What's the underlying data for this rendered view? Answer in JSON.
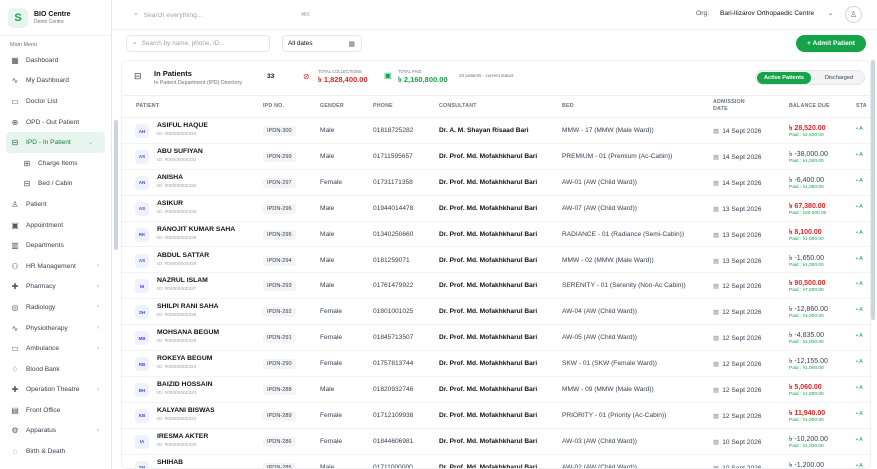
{
  "brand": {
    "logo": "S",
    "name": "BIO Centre",
    "sub": "Demo Centre"
  },
  "sidebar": {
    "heading": "Main Menu",
    "items": [
      {
        "label": "Dashboard",
        "icon": "▦",
        "icon_name": "dashboard-icon"
      },
      {
        "label": "My Dashboard",
        "icon": "∿",
        "icon_name": "activity-icon"
      },
      {
        "label": "Doctor List",
        "icon": "▭",
        "icon_name": "doctor-list-icon"
      },
      {
        "label": "OPD - Out Patient",
        "icon": "⊕",
        "icon_name": "opd-icon"
      },
      {
        "label": "IPD - In Patient",
        "icon": "⊟",
        "icon_name": "bed-icon",
        "chev": "⌄"
      },
      {
        "label": "Charge Items",
        "icon": "⊞",
        "icon_name": "charge-items-icon"
      },
      {
        "label": "Bed / Cabin",
        "icon": "⊟",
        "icon_name": "bed-cabin-icon"
      },
      {
        "label": "Patient",
        "icon": "♙",
        "icon_name": "patient-icon"
      },
      {
        "label": "Appointment",
        "icon": "▣",
        "icon_name": "calendar-icon"
      },
      {
        "label": "Departments",
        "icon": "▥",
        "icon_name": "departments-icon"
      },
      {
        "label": "HR Management",
        "icon": "⚇",
        "icon_name": "hr-icon",
        "chev": "›"
      },
      {
        "label": "Pharmacy",
        "icon": "✚",
        "icon_name": "pharmacy-icon",
        "chev": "›"
      },
      {
        "label": "Radiology",
        "icon": "◎",
        "icon_name": "radiology-icon",
        "chev": "›"
      },
      {
        "label": "Physiotherapy",
        "icon": "∿",
        "icon_name": "physio-icon",
        "chev": "›"
      },
      {
        "label": "Ambulance",
        "icon": "▭",
        "icon_name": "ambulance-icon",
        "chev": "›"
      },
      {
        "label": "Blood Bank",
        "icon": "♢",
        "icon_name": "blood-icon"
      },
      {
        "label": "Operation Theatre",
        "icon": "✚",
        "icon_name": "ot-icon",
        "chev": "›"
      },
      {
        "label": "Front Office",
        "icon": "▤",
        "icon_name": "front-office-icon"
      },
      {
        "label": "Apparatus",
        "icon": "⚙",
        "icon_name": "apparatus-icon",
        "chev": "›"
      },
      {
        "label": "Birth & Death",
        "icon": "◌",
        "icon_name": "birth-death-icon"
      }
    ]
  },
  "topbar": {
    "search_placeholder": "Search everything...",
    "search_kbd": "⌘K",
    "org_label": "Org:",
    "org_value": "Bari-Ilizarov Orthopaedic Centre",
    "org_chev": "⌄",
    "avatar_icon": "♙"
  },
  "filters": {
    "search_placeholder": "Search by name, phone, ID...",
    "date_value": "All dates",
    "calendar_icon": "▦",
    "admit_label": "+  Admit Patient"
  },
  "panel": {
    "icon": "⊟",
    "title": "In Patients",
    "subtitle": "In Patient Department (IPD) Directory",
    "count": "33",
    "collections_label": "TOTAL COLLECTIONS",
    "collections_value": "৳ 1,828,400.00",
    "paid_label": "TOTAL PAID",
    "paid_value": "৳ 2,160,800.00",
    "pending_text": "33 patients · current status",
    "toggle_active": "Active Patients",
    "toggle_discharged": "Discharged"
  },
  "columns": [
    "PATIENT",
    "IPD NO.",
    "GENDER",
    "PHONE",
    "CONSULTANT",
    "BED",
    "ADMISSION DATE",
    "BALANCE DUE",
    "STA"
  ],
  "rows": [
    {
      "initials": "AH",
      "name": "ASIFUL HAQUE",
      "pid": "ID: #00000000334",
      "ipd": "IPDN-300",
      "gender": "Male",
      "phone": "01818725282",
      "consultant": "Dr. A. M. Shayan Risaad Bari",
      "bed": "MMW - 17 (MMW (Male Ward))",
      "date": "14 Sept 2026",
      "balance": "৳ 28,520.00",
      "paid": "Paid : ৳2,600.00",
      "due": true
    },
    {
      "initials": "AS",
      "name": "ABU SUFIYAN",
      "pid": "ID: #00000000333",
      "ipd": "IPDN-299",
      "gender": "Male",
      "phone": "01711595657",
      "consultant": "Dr. Prof. Md. Mofakhkharul Bari",
      "bed": "PREMIUM - 01 (Premium (Ac-Cabin))",
      "date": "14 Sept 2026",
      "balance": "৳ -38,000.00",
      "paid": "Paid : ৳1,000.00",
      "due": false
    },
    {
      "initials": "AN",
      "name": "ANISHA",
      "pid": "ID: #00000000332",
      "ipd": "IPDN-297",
      "gender": "Female",
      "phone": "01731171358",
      "consultant": "Dr. Prof. Md. Mofakhkharul Bari",
      "bed": "AW-01 (AW (Child Ward))",
      "date": "14 Sept 2026",
      "balance": "৳ -6,400.00",
      "paid": "Paid : ৳1,050.00",
      "due": false
    },
    {
      "initials": "AS",
      "name": "ASIKUR",
      "pid": "ID: #00000000330",
      "ipd": "IPDN-296",
      "gender": "Male",
      "phone": "01944014478",
      "consultant": "Dr. Prof. Md. Mofakhkharul Bari",
      "bed": "AW-07 (AW (Child Ward))",
      "date": "13 Sept 2026",
      "balance": "৳ 67,380.00",
      "paid": "Paid : ৳20,000.00",
      "due": true
    },
    {
      "initials": "RK",
      "name": "RANOJIT KUMAR SAHA",
      "pid": "ID: #00000000329",
      "ipd": "IPDN-295",
      "gender": "Male",
      "phone": "01340250660",
      "consultant": "Dr. Prof. Md. Mofakhkharul Bari",
      "bed": "RADIANCE - 01 (Radiance (Semi-Cabin))",
      "date": "13 Sept 2026",
      "balance": "৳ 8,100.00",
      "paid": "Paid : ৳1,000.00",
      "due": true
    },
    {
      "initials": "AS",
      "name": "ABDUL SATTAR",
      "pid": "ID: #00000000328",
      "ipd": "IPDN-294",
      "gender": "Male",
      "phone": "0181259071",
      "consultant": "Dr. Prof. Md. Mofakhkharul Bari",
      "bed": "MMW - 02 (MMW (Male Ward))",
      "date": "13 Sept 2026",
      "balance": "৳ -1,650.00",
      "paid": "Paid : ৳1,000.00",
      "due": false
    },
    {
      "initials": "NI",
      "name": "NAZRUL ISLAM",
      "pid": "ID: #00000000327",
      "ipd": "IPDN-293",
      "gender": "Male",
      "phone": "01761479922",
      "consultant": "Dr. Prof. Md. Mofakhkharul Bari",
      "bed": "SERENITY - 01 (Serenity (Non-Ac Cabin))",
      "date": "12 Sept 2026",
      "balance": "৳ 90,500.00",
      "paid": "Paid : ৳7,000.00",
      "due": true
    },
    {
      "initials": "SH",
      "name": "SHILPI RANI SAHA",
      "pid": "ID: #00000000326",
      "ipd": "IPDN-292",
      "gender": "Female",
      "phone": "01801001025",
      "consultant": "Dr. Prof. Md. Mofakhkharul Bari",
      "bed": "AW-04 (AW (Child Ward))",
      "date": "12 Sept 2026",
      "balance": "৳ -12,860.00",
      "paid": "Paid : ৳1,000.00",
      "due": false
    },
    {
      "initials": "MB",
      "name": "MOHSANA BEGUM",
      "pid": "ID: #00000000325",
      "ipd": "IPDN-291",
      "gender": "Female",
      "phone": "01845713507",
      "consultant": "Dr. Prof. Md. Mofakhkharul Bari",
      "bed": "AW-05 (AW (Child Ward))",
      "date": "12 Sept 2026",
      "balance": "৳ -4,835.00",
      "paid": "Paid : ৳1,000.00",
      "due": false
    },
    {
      "initials": "RB",
      "name": "ROKEYA BEGUM",
      "pid": "ID: #00000000324",
      "ipd": "IPDN-290",
      "gender": "Female",
      "phone": "01757813744",
      "consultant": "Dr. Prof. Md. Mofakhkharul Bari",
      "bed": "SKW - 01 (SKW (Female Ward))",
      "date": "12 Sept 2026",
      "balance": "৳ -12,155.00",
      "paid": "Paid : ৳1,000.00",
      "due": false
    },
    {
      "initials": "BH",
      "name": "BAIZID HOSSAIN",
      "pid": "ID: #00000000323",
      "ipd": "IPDN-288",
      "gender": "Male",
      "phone": "01820932746",
      "consultant": "Dr. Prof. Md. Mofakhkharul Bari",
      "bed": "MMW - 09 (MMW (Male Ward))",
      "date": "12 Sept 2026",
      "balance": "৳ 5,060.00",
      "paid": "Paid : ৳1,000.00",
      "due": true
    },
    {
      "initials": "KB",
      "name": "KALYANI BISWAS",
      "pid": "ID: #00000000321",
      "ipd": "IPDN-289",
      "gender": "Female",
      "phone": "01712109938",
      "consultant": "Dr. Prof. Md. Mofakhkharul Bari",
      "bed": "PRIORITY - 01 (Priority (Ac-Cabin))",
      "date": "12 Sept 2026",
      "balance": "৳ 11,940.00",
      "paid": "Paid : ৳1,000.00",
      "due": true
    },
    {
      "initials": "IA",
      "name": "IRESMA AKTER",
      "pid": "ID: #00000000320",
      "ipd": "IPDN-286",
      "gender": "Female",
      "phone": "01844606981",
      "consultant": "Dr. Prof. Md. Mofakhkharul Bari",
      "bed": "AW-03 (AW (Child Ward))",
      "date": "10 Sept 2026",
      "balance": "৳ -10,200.00",
      "paid": "Paid : ৳1,000.00",
      "due": false
    },
    {
      "initials": "SH",
      "name": "SHIHAB",
      "pid": "ID: #00000000319",
      "ipd": "IPDN-285",
      "gender": "Male",
      "phone": "01711000000",
      "consultant": "Dr. Prof. Md. Mofakhkharul Bari",
      "bed": "AW-02 (AW (Child Ward))",
      "date": "10 Sept 2026",
      "balance": "৳ -1,200.00",
      "paid": "Paid : ৳1,000.00",
      "due": false
    }
  ],
  "status_icon": "• A",
  "colors": {
    "accent": "#16a34a",
    "due": "#dc2626"
  }
}
